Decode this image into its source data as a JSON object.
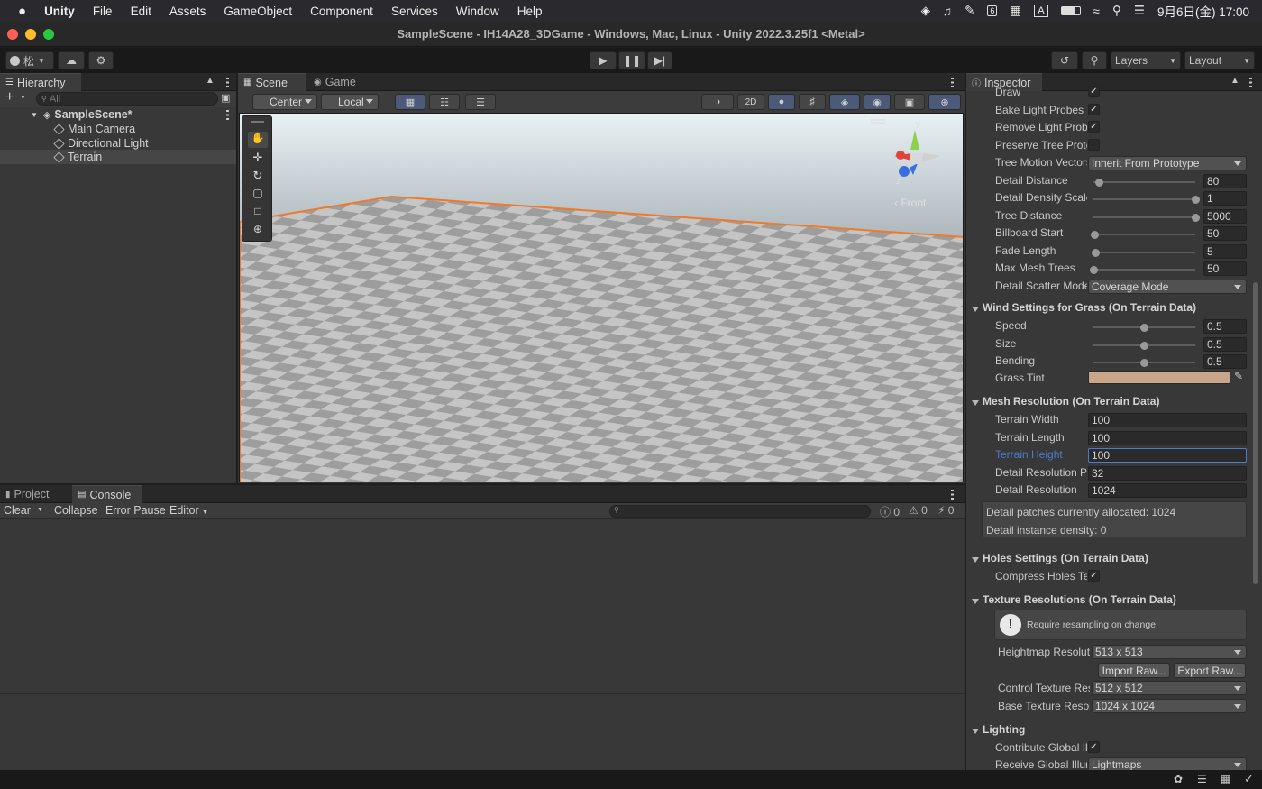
{
  "menubar": {
    "app": "Unity",
    "items": [
      "File",
      "Edit",
      "Assets",
      "GameObject",
      "Component",
      "Services",
      "Window",
      "Help"
    ],
    "input_method": "A",
    "datetime": "9月6日(金) 17:00",
    "calendar_day": "6"
  },
  "window": {
    "title": "SampleScene - IH14A28_3DGame - Windows, Mac, Linux - Unity 2022.3.25f1 <Metal>"
  },
  "toolbar": {
    "account_label": "松",
    "layers": "Layers",
    "layout": "Layout"
  },
  "hierarchy": {
    "tab": "Hierarchy",
    "search_placeholder": "All",
    "scene": "SampleScene*",
    "items": [
      "Main Camera",
      "Directional Light",
      "Terrain"
    ]
  },
  "scene_tabs": {
    "scene": "Scene",
    "game": "Game",
    "pivot": "Center",
    "space": "Local",
    "mode_2d": "2D",
    "gizmo_label": "Front",
    "axis_x": "x",
    "axis_y": "y",
    "axis_z": "z"
  },
  "bottom": {
    "tabs": [
      "Project",
      "Console"
    ],
    "buttons": {
      "clear": "Clear",
      "collapse": "Collapse",
      "error_pause": "Error Pause",
      "editor": "Editor"
    },
    "counts": [
      "0",
      "0",
      "0"
    ]
  },
  "inspector": {
    "tab": "Inspector",
    "rows_top": [
      {
        "label": "Draw",
        "type": "check"
      },
      {
        "label": "Bake Light Probes",
        "type": "check"
      },
      {
        "label": "Remove Light Probes",
        "type": "check"
      },
      {
        "label": "Preserve Tree Prototype",
        "type": "empty"
      },
      {
        "label": "Tree Motion Vectors",
        "type": "dropdown",
        "value": "Inherit From Prototype"
      },
      {
        "label": "Detail Distance",
        "type": "slider",
        "value": "80",
        "pos": 0.06
      },
      {
        "label": "Detail Density Scale",
        "type": "slider",
        "value": "1",
        "pos": 1.0
      },
      {
        "label": "Tree Distance",
        "type": "slider",
        "value": "5000",
        "pos": 1.0
      },
      {
        "label": "Billboard Start",
        "type": "slider",
        "value": "50",
        "pos": 0.02
      },
      {
        "label": "Fade Length",
        "type": "slider",
        "value": "5",
        "pos": 0.03
      },
      {
        "label": "Max Mesh Trees",
        "type": "slider",
        "value": "50",
        "pos": 0.01
      },
      {
        "label": "Detail Scatter Mode",
        "type": "dropdown",
        "value": "Coverage Mode"
      }
    ],
    "wind": {
      "title": "Wind Settings for Grass (On Terrain Data)",
      "rows": [
        {
          "label": "Speed",
          "value": "0.5",
          "pos": 0.5
        },
        {
          "label": "Size",
          "value": "0.5",
          "pos": 0.5
        },
        {
          "label": "Bending",
          "value": "0.5",
          "pos": 0.5
        }
      ],
      "tint_label": "Grass Tint",
      "tint_color": "#c9a68a"
    },
    "mesh": {
      "title": "Mesh Resolution (On Terrain Data)",
      "rows": [
        {
          "label": "Terrain Width",
          "value": "100"
        },
        {
          "label": "Terrain Length",
          "value": "100"
        },
        {
          "label": "Terrain Height",
          "value": "100"
        },
        {
          "label": "Detail Resolution Per Patch",
          "value": "32"
        },
        {
          "label": "Detail Resolution",
          "value": "1024"
        }
      ],
      "info1": "Detail patches currently allocated: 1024",
      "info2": "Detail instance density: 0"
    },
    "holes": {
      "title": "Holes Settings (On Terrain Data)",
      "label": "Compress Holes Texture"
    },
    "texture": {
      "title": "Texture Resolutions (On Terrain Data)",
      "warning": "Require resampling on change",
      "heightmap_label": "Heightmap Resolution",
      "heightmap": "513 x 513",
      "import": "Import Raw...",
      "export": "Export Raw...",
      "control_label": "Control Texture Resolution",
      "control": "512 x 512",
      "base_label": "Base Texture Resolution",
      "base": "1024 x 1024"
    },
    "lighting": {
      "title": "Lighting",
      "contribute": "Contribute Global Illumination",
      "receive_label": "Receive Global Illumination",
      "receive": "Lightmaps"
    }
  },
  "colors": {
    "selection": "#4d7cc9",
    "terrain_outline": "#f07a2a"
  }
}
